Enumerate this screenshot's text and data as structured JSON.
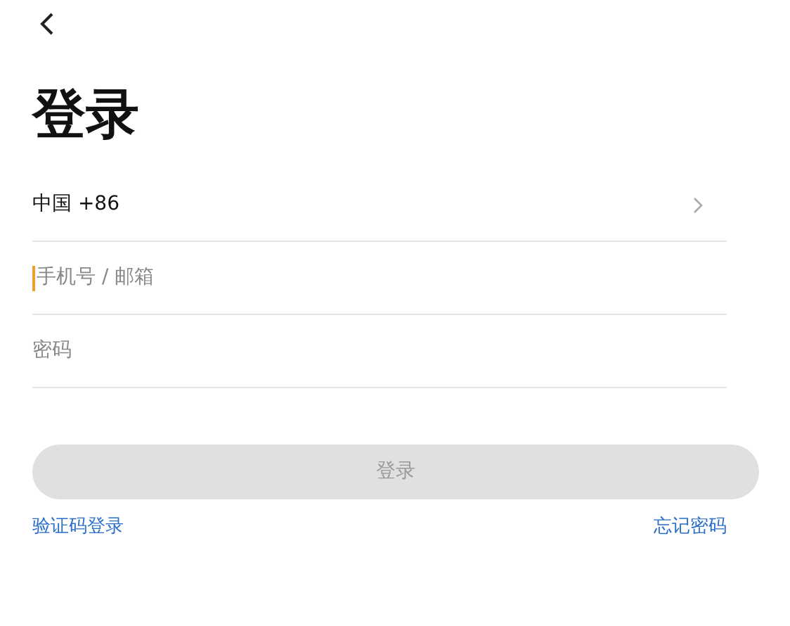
{
  "title": "登录",
  "country": {
    "label": "中国 +86"
  },
  "fields": [
    {
      "placeholder": "手机号 / 邮箱",
      "focused": true
    },
    {
      "placeholder": "密码",
      "focused": false
    }
  ],
  "login_button": {
    "label": "登录",
    "disabled": true
  },
  "links": [
    "验证码登录",
    "忘记密码"
  ]
}
